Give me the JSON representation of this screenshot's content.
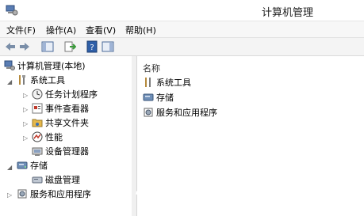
{
  "window": {
    "title": "计算机管理"
  },
  "menu": [
    {
      "label": "文件(F)"
    },
    {
      "label": "操作(A)"
    },
    {
      "label": "查看(V)"
    },
    {
      "label": "帮助(H)"
    }
  ],
  "toolbar": {
    "buttons": [
      "back-arrow-icon",
      "forward-arrow-icon",
      "show-hide-tree-icon",
      "export-list-icon",
      "help-icon",
      "show-action-pane-icon"
    ]
  },
  "tree": {
    "root": "计算机管理(本地)",
    "system_tools": "系统工具",
    "task_scheduler": "任务计划程序",
    "event_viewer": "事件查看器",
    "shared_folders": "共享文件夹",
    "performance": "性能",
    "device_manager": "设备管理器",
    "storage": "存储",
    "disk_management": "磁盘管理",
    "services_apps": "服务和应用程序"
  },
  "list": {
    "header": "名称",
    "items": [
      "系统工具",
      "存储",
      "服务和应用程序"
    ]
  },
  "colors": {
    "accent": "#1e5fb4",
    "arrow": "#ffffff"
  }
}
